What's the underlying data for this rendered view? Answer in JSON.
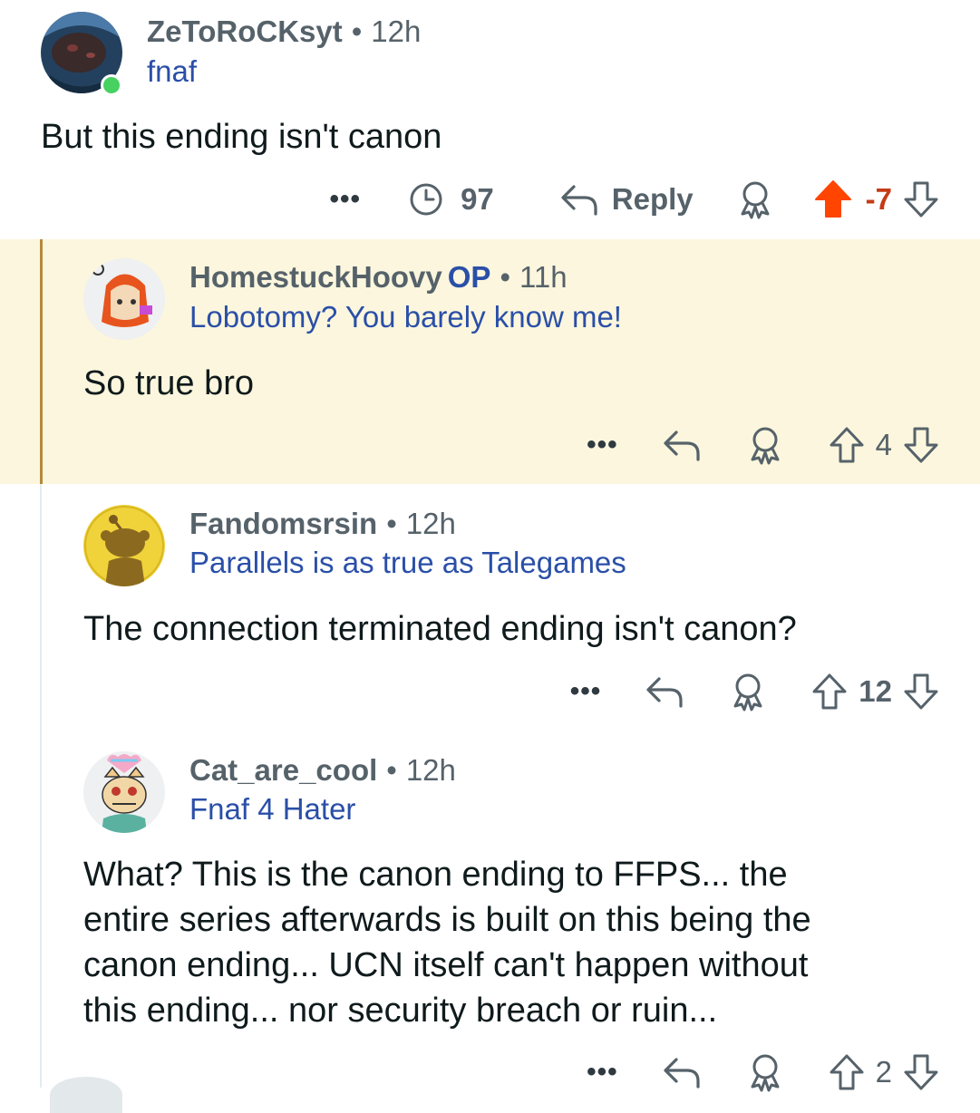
{
  "comments": [
    {
      "username": "ZeToRoCKsyt",
      "time": "12h",
      "flair": "fnaf",
      "body": "But this ending isn't canon",
      "views": "97",
      "reply_label": "Reply",
      "score": "-7",
      "upvoted": true
    },
    {
      "username": "HomestuckHoovy",
      "op_badge": "OP",
      "time": "11h",
      "flair": "Lobotomy? You barely know me!",
      "body": "So true bro",
      "score": "4",
      "highlighted": true
    },
    {
      "username": "Fandomsrsin",
      "time": "12h",
      "flair": "Parallels is as true as Talegames",
      "body": "The connection terminated ending isn't canon?",
      "score": "12"
    },
    {
      "username": "Cat_are_cool",
      "time": "12h",
      "flair": "Fnaf 4 Hater",
      "body_lines": [
        "What? This is the canon ending to FFPS... the",
        "entire series afterwards is built on this being the",
        "canon ending... UCN itself can't happen without",
        "this ending... nor security breach or ruin..."
      ],
      "score": "2"
    }
  ],
  "separator": "•",
  "more_glyph": "•••",
  "colors": {
    "upvote_active": "#ff4500",
    "negative_score": "#c43b16",
    "flair_blue": "#2a4fa8",
    "highlight_bg": "#fbf6dd",
    "thread_line_active": "#b58a3b"
  },
  "icons": [
    "avatar",
    "online-dot",
    "more-icon",
    "views-icon",
    "reply-icon",
    "award-icon",
    "upvote-icon",
    "downvote-icon"
  ]
}
